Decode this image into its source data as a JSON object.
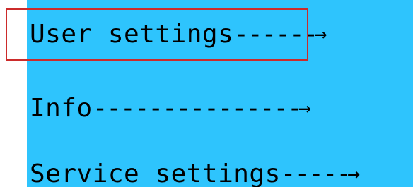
{
  "menu": {
    "items": [
      {
        "label": "User settings",
        "dashes": "------",
        "arrow": "→"
      },
      {
        "label": "Info",
        "dashes": "---------------",
        "arrow": "→"
      },
      {
        "label": "Service settings",
        "dashes": "-----",
        "arrow": "→"
      }
    ],
    "selected_index": 0
  },
  "colors": {
    "lcd_background": "#2ec4fd",
    "text": "#000000",
    "selection_outline": "#cc2b2b"
  }
}
